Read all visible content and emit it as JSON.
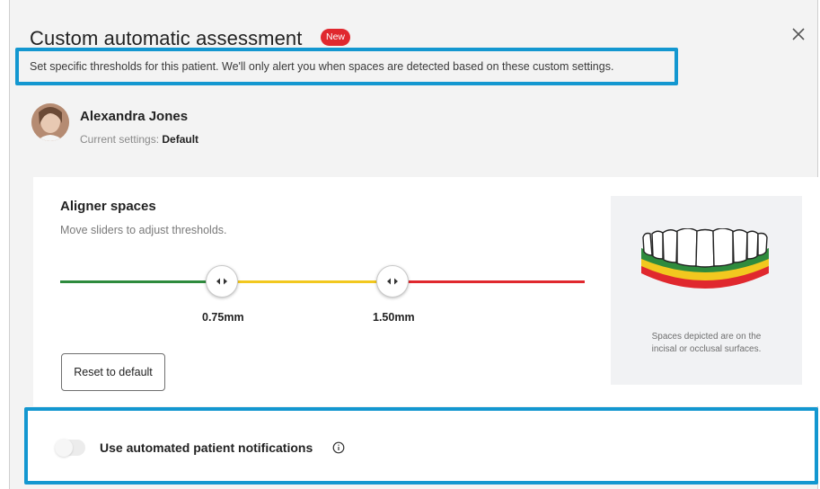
{
  "dialog": {
    "title": "Custom automatic assessment",
    "badge": "New",
    "subtitle": "Set specific thresholds for this patient. We'll only alert you when spaces are detected based on these custom settings.",
    "close_icon": "close-icon"
  },
  "patient": {
    "name": "Alexandra Jones",
    "settings_label": "Current settings: ",
    "settings_value": "Default"
  },
  "aligner": {
    "title": "Aligner spaces",
    "description": "Move sliders to adjust thresholds.",
    "thresholds": [
      {
        "label": "0.75mm",
        "value": 0.75
      },
      {
        "label": "1.50mm",
        "value": 1.5
      }
    ],
    "zone_colors": {
      "low": "#2e8b3d",
      "mid": "#f2c81f",
      "high": "#e0282e"
    },
    "reset_label": "Reset to default",
    "illustration_caption_line1": "Spaces depicted are on the",
    "illustration_caption_line2": "incisal or occlusal surfaces."
  },
  "notifications": {
    "label": "Use automated patient notifications",
    "enabled": false,
    "info_icon": "info-icon"
  },
  "colors": {
    "highlight": "#1397d0",
    "badge": "#e0282e"
  }
}
